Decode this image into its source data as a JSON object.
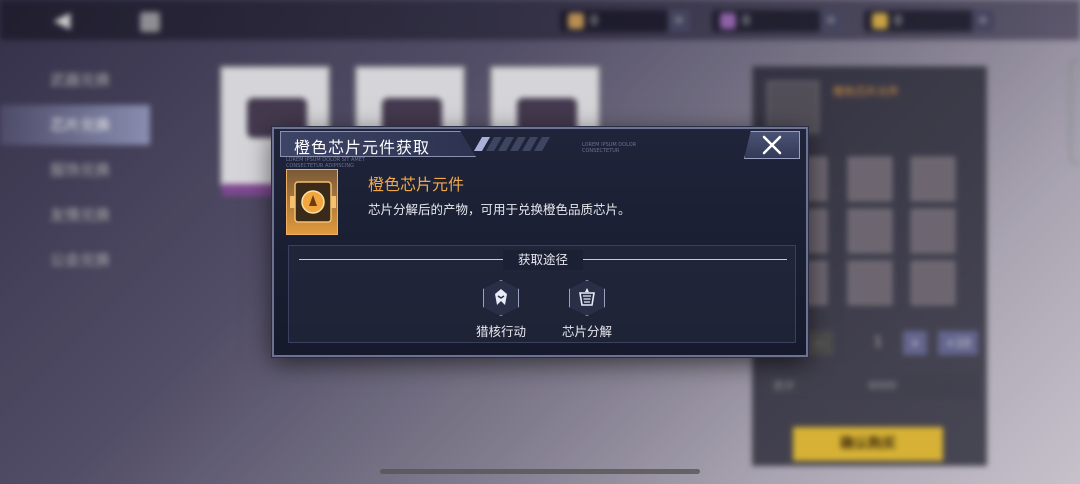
{
  "background": {
    "back_icon": "back-arrow-icon",
    "currencies": [
      {
        "icon": "crown-coin-icon",
        "value": "0",
        "plus": "+"
      },
      {
        "icon": "purple-gem-icon",
        "value": "0",
        "plus": "+"
      },
      {
        "icon": "gold-ticket-icon",
        "value": "0",
        "plus": "+"
      }
    ],
    "sidebar": [
      "武器兑换",
      "芯片兑换",
      "服饰兑换",
      "友情兑换",
      "公会兑换"
    ],
    "active_sidebar_index": 1,
    "detail_panel": {
      "title": "橙色芯片元件",
      "quantity": "1",
      "minus": "—",
      "plus": "+",
      "max": "+10",
      "cost_label": "合计",
      "cost_value": "6000",
      "confirm": "确认购买"
    }
  },
  "dialog": {
    "title": "橙色芯片元件获取",
    "lorem_top": "LOREM IPSUM DOLOR CONSECTETUR",
    "lorem_left": "LOREM IPSUM DOLOR SIT AMET CONSECTETUR ADIPISCING",
    "item": {
      "name": "橙色芯片元件",
      "description": "芯片分解后的产物，可用于兑换橙色品质芯片。",
      "icon": "orange-chip-component-icon"
    },
    "sources_title": "获取途径",
    "sources": [
      {
        "label": "猎核行动",
        "icon": "hunt-operation-icon"
      },
      {
        "label": "芯片分解",
        "icon": "chip-decompose-icon"
      }
    ],
    "close_icon": "close-icon"
  },
  "colors": {
    "accent_orange": "#f0a848",
    "dialog_bg": "#1c2034",
    "dialog_border": "#6c7290"
  }
}
